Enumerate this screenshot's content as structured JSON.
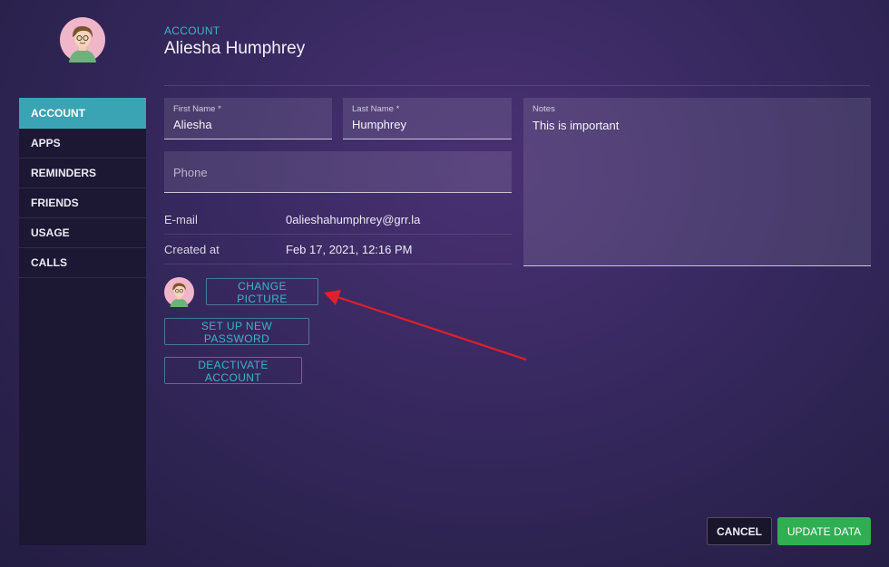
{
  "header": {
    "section": "ACCOUNT",
    "name": "Aliesha Humphrey"
  },
  "sidebar": {
    "items": [
      {
        "label": "ACCOUNT",
        "active": true
      },
      {
        "label": "APPS"
      },
      {
        "label": "REMINDERS"
      },
      {
        "label": "FRIENDS"
      },
      {
        "label": "USAGE"
      },
      {
        "label": "CALLS"
      }
    ]
  },
  "form": {
    "first_name": {
      "label": "First Name *",
      "value": "Aliesha"
    },
    "last_name": {
      "label": "Last Name *",
      "value": "Humphrey"
    },
    "phone": {
      "placeholder": "Phone",
      "value": ""
    },
    "notes": {
      "label": "Notes",
      "value": "This is important"
    }
  },
  "info": {
    "email": {
      "label": "E-mail",
      "value": "0alieshahumphrey@grr.la"
    },
    "created": {
      "label": "Created at",
      "value": "Feb 17, 2021, 12:16 PM"
    }
  },
  "actions": {
    "change_picture": "CHANGE PICTURE",
    "set_password": "SET UP NEW PASSWORD",
    "deactivate": "DEACTIVATE ACCOUNT",
    "cancel": "CANCEL",
    "update": "UPDATE DATA"
  },
  "colors": {
    "accent": "#3fb3c8",
    "active_tab": "#3aa3b4",
    "update_button": "#2fae52",
    "annotation_arrow": "#e0202a"
  },
  "icons": {
    "avatar": "user-avatar-icon"
  }
}
